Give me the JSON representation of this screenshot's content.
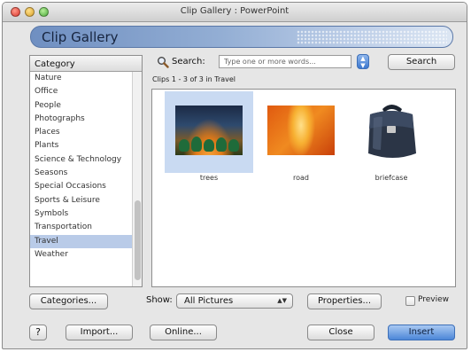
{
  "window": {
    "title": "Clip Gallery : PowerPoint"
  },
  "banner": {
    "title": "Clip Gallery"
  },
  "category": {
    "header": "Category",
    "items": [
      {
        "label": "Nature"
      },
      {
        "label": "Office"
      },
      {
        "label": "People"
      },
      {
        "label": "Photographs"
      },
      {
        "label": "Places"
      },
      {
        "label": "Plants"
      },
      {
        "label": "Science & Technology"
      },
      {
        "label": "Seasons"
      },
      {
        "label": "Special Occasions"
      },
      {
        "label": "Sports & Leisure"
      },
      {
        "label": "Symbols"
      },
      {
        "label": "Transportation"
      },
      {
        "label": "Travel",
        "selected": true
      },
      {
        "label": "Weather"
      }
    ]
  },
  "search": {
    "label": "Search:",
    "placeholder": "Type one or more words...",
    "button_label": "Search"
  },
  "results": {
    "count_text": "Clips 1 - 3 of 3 in Travel",
    "clips": [
      {
        "label": "trees",
        "selected": true
      },
      {
        "label": "road",
        "selected": false
      },
      {
        "label": "briefcase",
        "selected": false
      }
    ]
  },
  "show": {
    "label": "Show:",
    "selected": "All Pictures"
  },
  "buttons": {
    "categories": "Categories...",
    "properties": "Properties...",
    "help": "?",
    "import": "Import...",
    "online": "Online...",
    "close": "Close",
    "insert": "Insert"
  },
  "preview": {
    "label": "Preview",
    "checked": false
  },
  "colors": {
    "selection": "#b9cbe8",
    "accent_button": "#4c87d8",
    "banner": "#6f8fc1"
  }
}
